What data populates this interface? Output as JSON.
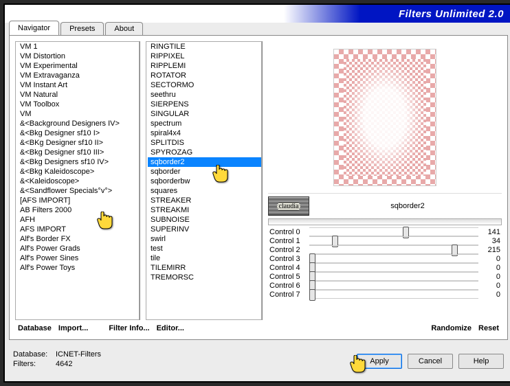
{
  "title": "Filters Unlimited 2.0",
  "tabs": [
    "Navigator",
    "Presets",
    "About"
  ],
  "active_tab": 0,
  "categories": [
    "VM 1",
    "VM Distortion",
    "VM Experimental",
    "VM Extravaganza",
    "VM Instant Art",
    "VM Natural",
    "VM Toolbox",
    "VM",
    "&<Background Designers IV>",
    "&<Bkg Designer sf10 I>",
    "&<BKg Designer sf10 II>",
    "&<Bkg Designer sf10 III>",
    "&<Bkg Designers sf10 IV>",
    "&<Bkg Kaleidoscope>",
    "&<Kaleidoscope>",
    "&<Sandflower Specials°v°>",
    "[AFS IMPORT]",
    "AB Filters 2000",
    "AFH",
    "AFS IMPORT",
    "Alf's Border FX",
    "Alf's Power Grads",
    "Alf's Power Sines",
    "Alf's Power Toys"
  ],
  "selected_category": "[AFS IMPORT]",
  "filters": [
    "RINGTILE",
    "RIPPIXEL",
    "RIPPLEMI",
    "ROTATOR",
    "SECTORMO",
    "seethru",
    "SIERPENS",
    "SINGULAR",
    "spectrum",
    "spiral4x4",
    "SPLITDIS",
    "SPYROZAG",
    "sqborder2",
    "sqborder",
    "sqborderbw",
    "squares",
    "STREAKER",
    "STREAKMI",
    "SUBNOISE",
    "SUPERINV",
    "swirl",
    "test",
    "tile",
    "TILEMIRR",
    "TREMORSC"
  ],
  "selected_filter": "sqborder2",
  "badge_text": "claudia",
  "controls": [
    {
      "label": "Control 0",
      "value": 141
    },
    {
      "label": "Control 1",
      "value": 34
    },
    {
      "label": "Control 2",
      "value": 215
    },
    {
      "label": "Control 3",
      "value": 0
    },
    {
      "label": "Control 4",
      "value": 0
    },
    {
      "label": "Control 5",
      "value": 0
    },
    {
      "label": "Control 6",
      "value": 0
    },
    {
      "label": "Control 7",
      "value": 0
    }
  ],
  "slider_max": 255,
  "links": {
    "database": "Database",
    "import": "Import...",
    "filterinfo": "Filter Info...",
    "editor": "Editor...",
    "randomize": "Randomize",
    "reset": "Reset"
  },
  "status": {
    "db_label": "Database:",
    "db_value": "ICNET-Filters",
    "filters_label": "Filters:",
    "filters_value": "4642"
  },
  "buttons": {
    "apply": "Apply",
    "cancel": "Cancel",
    "help": "Help"
  }
}
